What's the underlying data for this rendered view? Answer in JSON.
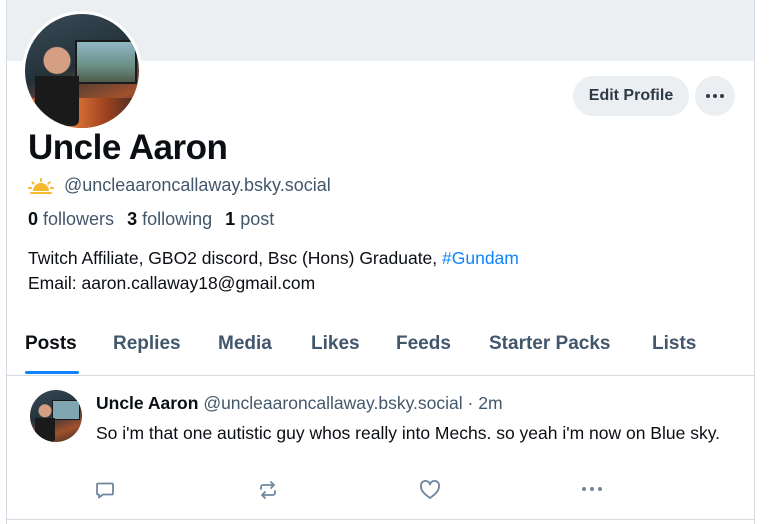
{
  "profile": {
    "display_name": "Uncle Aaron",
    "handle": "@uncleaaroncallaway.bsky.social",
    "edit_label": "Edit Profile",
    "stats": {
      "followers_count": "0",
      "followers_label": "followers",
      "following_count": "3",
      "following_label": "following",
      "posts_count": "1",
      "posts_label": "post"
    },
    "bio_line1_text": "Twitch Affiliate, GBO2 discord, Bsc (Hons) Graduate, ",
    "bio_hashtag": "#Gundam",
    "bio_line2": "Email: aaron.callaway18@gmail.com"
  },
  "tabs": [
    {
      "label": "Posts",
      "active": true
    },
    {
      "label": "Replies"
    },
    {
      "label": "Media"
    },
    {
      "label": "Likes"
    },
    {
      "label": "Feeds"
    },
    {
      "label": "Starter Packs"
    },
    {
      "label": "Lists"
    }
  ],
  "post": {
    "author_name": "Uncle Aaron",
    "author_handle": "@uncleaaroncallaway.bsky.social",
    "separator": "·",
    "time": "2m",
    "text": "So i'm that one autistic guy whos really into Mechs. so yeah i'm now on Blue sky."
  },
  "icons": {
    "handle_badge": "sun-rising-icon",
    "more": "more-dots-icon",
    "reply": "comment-icon",
    "repost": "repost-icon",
    "like": "heart-icon",
    "post_more": "more-dots-icon"
  },
  "colors": {
    "accent": "#1083fe",
    "muted_text": "#42576c",
    "banner": "#eceff2",
    "sun": "#f5b82e"
  }
}
